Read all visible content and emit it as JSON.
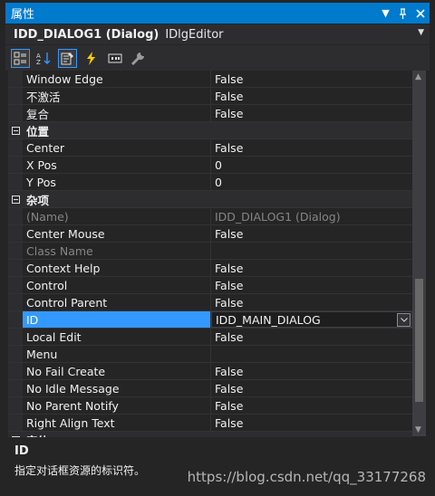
{
  "window": {
    "title": "属性"
  },
  "object": {
    "name": "IDD_DIALOG1 (Dialog)",
    "type": "IDlgEditor"
  },
  "toolbar": {
    "buttons": [
      {
        "icon": "categorized-icon",
        "active": true
      },
      {
        "icon": "alphabetical-icon",
        "active": false
      },
      {
        "icon": "properties-icon",
        "active": true
      },
      {
        "icon": "events-icon",
        "active": false
      },
      {
        "icon": "messages-icon",
        "active": false
      },
      {
        "icon": "overrides-icon",
        "active": false
      }
    ]
  },
  "rows": [
    {
      "kind": "prop",
      "name": "Window Edge",
      "value": "False"
    },
    {
      "kind": "prop",
      "name": "不激活",
      "value": "False"
    },
    {
      "kind": "prop",
      "name": "复合",
      "value": "False"
    },
    {
      "kind": "cat",
      "name": "位置"
    },
    {
      "kind": "prop",
      "name": "Center",
      "value": "False"
    },
    {
      "kind": "prop",
      "name": "X Pos",
      "value": "0"
    },
    {
      "kind": "prop",
      "name": "Y Pos",
      "value": "0"
    },
    {
      "kind": "cat",
      "name": "杂项"
    },
    {
      "kind": "prop",
      "name": "(Name)",
      "value": "IDD_DIALOG1 (Dialog)",
      "disabled": true
    },
    {
      "kind": "prop",
      "name": "Center Mouse",
      "value": "False"
    },
    {
      "kind": "prop",
      "name": "Class Name",
      "value": "",
      "disabled": true
    },
    {
      "kind": "prop",
      "name": "Context Help",
      "value": "False"
    },
    {
      "kind": "prop",
      "name": "Control",
      "value": "False"
    },
    {
      "kind": "prop",
      "name": "Control Parent",
      "value": "False"
    },
    {
      "kind": "prop",
      "name": "ID",
      "value": "IDD_MAIN_DIALOG",
      "selected": true
    },
    {
      "kind": "prop",
      "name": "Local Edit",
      "value": "False"
    },
    {
      "kind": "prop",
      "name": "Menu",
      "value": ""
    },
    {
      "kind": "prop",
      "name": "No Fail Create",
      "value": "False"
    },
    {
      "kind": "prop",
      "name": "No Idle Message",
      "value": "False"
    },
    {
      "kind": "prop",
      "name": "No Parent Notify",
      "value": "False"
    },
    {
      "kind": "prop",
      "name": "Right Align Text",
      "value": "False"
    },
    {
      "kind": "cat",
      "name": "字体"
    }
  ],
  "description": {
    "title": "ID",
    "text": "指定对话框资源的标识符。"
  },
  "watermark": "https://blog.csdn.net/qq_33177268"
}
